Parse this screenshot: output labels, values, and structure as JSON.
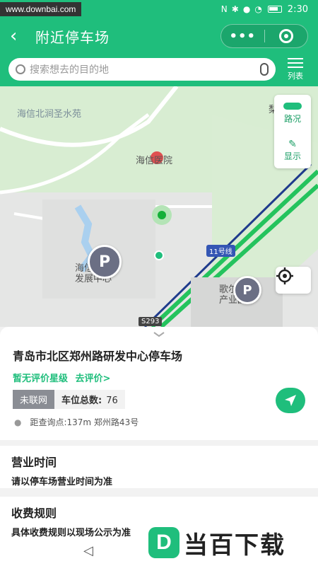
{
  "status_bar": {
    "watermark": "www.downbai.com",
    "time": "2:30",
    "icons": [
      "nfc-icon",
      "vibrate-icon",
      "bluetooth-icon",
      "location-icon",
      "alarm-icon",
      "wifi-icon",
      "battery-icon"
    ]
  },
  "header": {
    "title": "附近停车场",
    "more": "•••",
    "search_placeholder": "搜索想去的目的地",
    "list_label": "列表"
  },
  "map": {
    "labels": {
      "community": "海信北涧圣水苑",
      "hospital": "海信医院",
      "line11": "11号线",
      "s293": "S293",
      "building_left": "海信\n发展中心",
      "building_right": "歌尔电子\n产业园",
      "edge": "梨"
    },
    "tools": {
      "traffic": "路况",
      "display": "显示"
    }
  },
  "card": {
    "name": "青岛市北区郑州路研发中心停车场",
    "no_rating": "暂无评价星级",
    "go_rate": "去评价>",
    "status_tag": "未联网",
    "spaces_label": "车位总数:",
    "spaces_value": "76",
    "distance": "距查询点:137m 郑州路43号"
  },
  "sections": {
    "hours_title": "营业时间",
    "hours_body": "请以停车场营业时间为准",
    "fee_title": "收费规则",
    "fee_body": "具体收费规则以现场公示为准"
  },
  "overlay": {
    "logo": "D",
    "brand": "当百下载"
  },
  "colors": {
    "primary": "#1fbe7c",
    "pin": "#6b6f84"
  }
}
